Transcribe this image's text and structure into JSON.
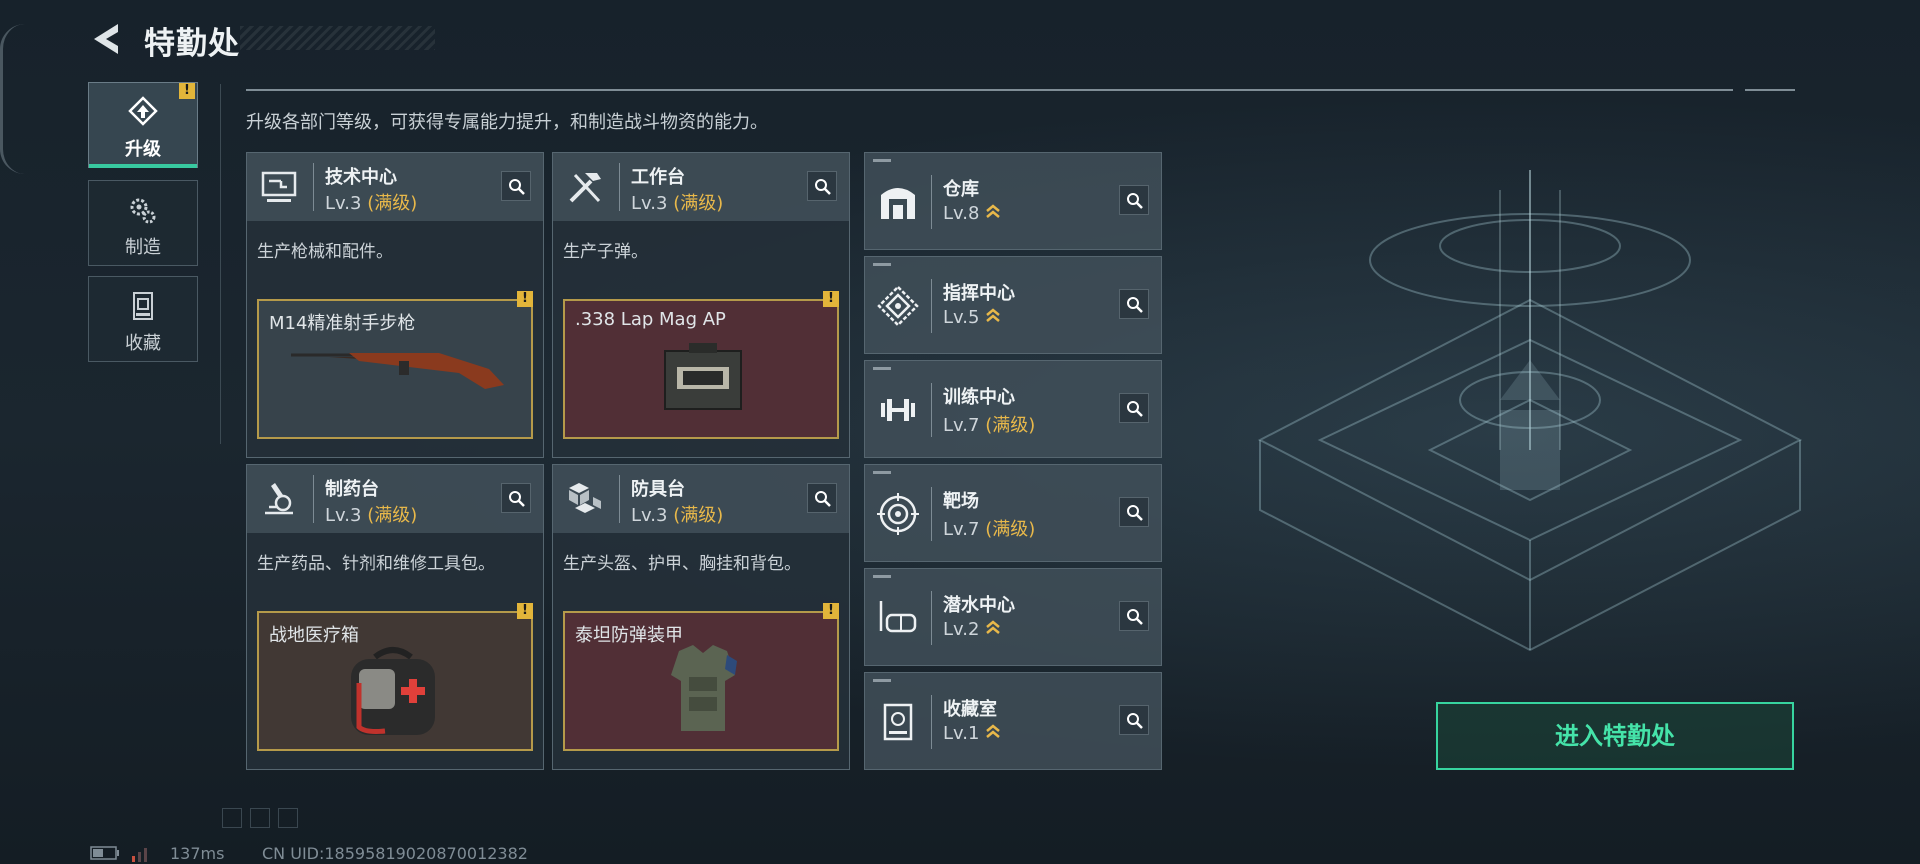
{
  "header": {
    "title": "特勤处"
  },
  "sidebar": {
    "tabs": [
      {
        "label": "升级",
        "icon": "upgrade-icon",
        "active": true,
        "alert": "!"
      },
      {
        "label": "制造",
        "icon": "gears-icon",
        "active": false
      },
      {
        "label": "收藏",
        "icon": "collection-icon",
        "active": false
      }
    ]
  },
  "description": "升级各部门等级，可获得专属能力提升，和制造战斗物资的能力。",
  "cards": [
    {
      "name": "技术中心",
      "level": "Lv.3",
      "max": "(满级)",
      "desc": "生产枪械和配件。",
      "item": "M14精准射手步枪",
      "icon": "computer-icon",
      "alert": "!"
    },
    {
      "name": "工作台",
      "level": "Lv.3",
      "max": "(满级)",
      "desc": "生产子弹。",
      "item": ".338 Lap Mag AP",
      "icon": "tools-icon",
      "alert": "!"
    },
    {
      "name": "制药台",
      "level": "Lv.3",
      "max": "(满级)",
      "desc": "生产药品、针剂和维修工具包。",
      "item": "战地医疗箱",
      "icon": "microscope-icon",
      "alert": "!"
    },
    {
      "name": "防具台",
      "level": "Lv.3",
      "max": "(满级)",
      "desc": "生产头盔、护甲、胸挂和背包。",
      "item": "泰坦防弹装甲",
      "icon": "cubes-icon",
      "alert": "!"
    }
  ],
  "departments": [
    {
      "name": "仓库",
      "level": "Lv.8",
      "max": "",
      "icon": "warehouse-icon"
    },
    {
      "name": "指挥中心",
      "level": "Lv.5",
      "max": "",
      "icon": "command-icon"
    },
    {
      "name": "训练中心",
      "level": "Lv.7",
      "max": "(满级)",
      "icon": "dumbbell-icon"
    },
    {
      "name": "靶场",
      "level": "Lv.7",
      "max": "(满级)",
      "icon": "target-icon"
    },
    {
      "name": "潜水中心",
      "level": "Lv.2",
      "max": "",
      "icon": "diving-mask-icon"
    },
    {
      "name": "收藏室",
      "level": "Lv.1",
      "max": "",
      "icon": "collection-room-icon"
    }
  ],
  "enter_button": "进入特勤处",
  "footer": {
    "ping": "137ms",
    "uid": "CN UID:18595819020870012382"
  },
  "colors": {
    "accent": "#38c9a0",
    "max_level": "#e8b84a",
    "alert": "#e2b53a",
    "upgrade_arrow": "#e8b84a"
  }
}
